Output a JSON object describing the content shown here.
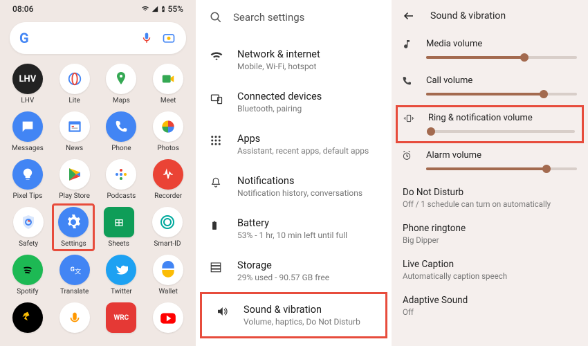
{
  "statusbar": {
    "time": "08:06",
    "battery": "55%"
  },
  "searchbar": {
    "mic": "mic",
    "cam": "camera"
  },
  "apps": {
    "row0": [
      {
        "label": "LHV"
      },
      {
        "label": "Lite"
      },
      {
        "label": "Maps"
      },
      {
        "label": "Meet"
      }
    ],
    "row1": [
      {
        "label": "Messages"
      },
      {
        "label": "News"
      },
      {
        "label": "Phone"
      },
      {
        "label": "Photos"
      }
    ],
    "row2": [
      {
        "label": "Pixel Tips"
      },
      {
        "label": "Play Store"
      },
      {
        "label": "Podcasts"
      },
      {
        "label": "Recorder"
      }
    ],
    "row3": [
      {
        "label": "Safety"
      },
      {
        "label": "Settings"
      },
      {
        "label": "Sheets"
      },
      {
        "label": "Smart-ID"
      }
    ],
    "row4": [
      {
        "label": "Spotify"
      },
      {
        "label": "Translate"
      },
      {
        "label": "Twitter"
      },
      {
        "label": "Wallet"
      }
    ],
    "row5": [
      {
        "label": ""
      },
      {
        "label": ""
      },
      {
        "label": ""
      },
      {
        "label": ""
      }
    ]
  },
  "settings_search": {
    "placeholder": "Search settings"
  },
  "settings_list": [
    {
      "title": "Network & internet",
      "sub": "Mobile, Wi-Fi, hotspot"
    },
    {
      "title": "Connected devices",
      "sub": "Bluetooth, pairing"
    },
    {
      "title": "Apps",
      "sub": "Assistant, recent apps, default apps"
    },
    {
      "title": "Notifications",
      "sub": "Notification history, conversations"
    },
    {
      "title": "Battery",
      "sub": "53% - 1 hr, 10 min left until full"
    },
    {
      "title": "Storage",
      "sub": "29% used - 90.57 GB free"
    },
    {
      "title": "Sound & vibration",
      "sub": "Volume, haptics, Do Not Disturb"
    }
  ],
  "sound_page": {
    "title": "Sound & vibration",
    "volumes": {
      "media": {
        "label": "Media volume",
        "pct": 65
      },
      "call": {
        "label": "Call volume",
        "pct": 78
      },
      "ring": {
        "label": "Ring & notification volume",
        "pct": 2
      },
      "alarm": {
        "label": "Alarm volume",
        "pct": 80
      }
    },
    "items": [
      {
        "title": "Do Not Disturb",
        "sub": "Off / 1 schedule can turn on automatically"
      },
      {
        "title": "Phone ringtone",
        "sub": "Big Dipper"
      },
      {
        "title": "Live Caption",
        "sub": "Automatically caption speech"
      },
      {
        "title": "Adaptive Sound",
        "sub": "Off"
      }
    ]
  }
}
